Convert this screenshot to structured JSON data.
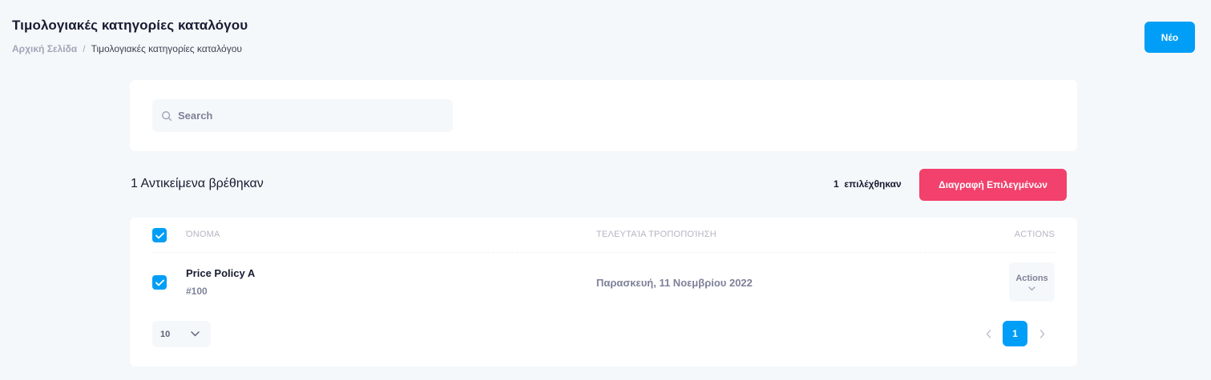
{
  "header": {
    "title": "Τιμολογιακές κατηγορίες καταλόγου",
    "breadcrumb": {
      "home": "Αρχική Σελίδα",
      "separator": "/",
      "current": "Τιμολογιακές κατηγορίες καταλόγου"
    },
    "new_button": "Νέο"
  },
  "search": {
    "placeholder": "Search",
    "icon": "search-icon"
  },
  "toolbar": {
    "results_count": "1 Αντικείμενα βρέθηκαν",
    "selected_count": "1",
    "selected_label": "επιλέχθηκαν",
    "delete_button": "Διαγραφή Επιλεγμένων"
  },
  "table": {
    "columns": {
      "name": "ΌΝΟΜΑ",
      "modified": "ΤΕΛΕΥΤΑΊΑ ΤΡΟΠΟΠΟΊΗΣΗ",
      "actions": "ACTIONS"
    },
    "select_all_checked": true,
    "rows": [
      {
        "checked": true,
        "name": "Price Policy A",
        "code": "#100",
        "modified": "Παρασκευή, 11 Νοεμβρίου 2022",
        "actions_label": "Actions"
      }
    ]
  },
  "pagination": {
    "page_size": "10",
    "current_page": "1",
    "prev_icon": "chevron-left-icon",
    "next_icon": "chevron-right-icon"
  },
  "colors": {
    "primary": "#009ef7",
    "danger": "#f1416c",
    "background": "#f5f8fa"
  }
}
